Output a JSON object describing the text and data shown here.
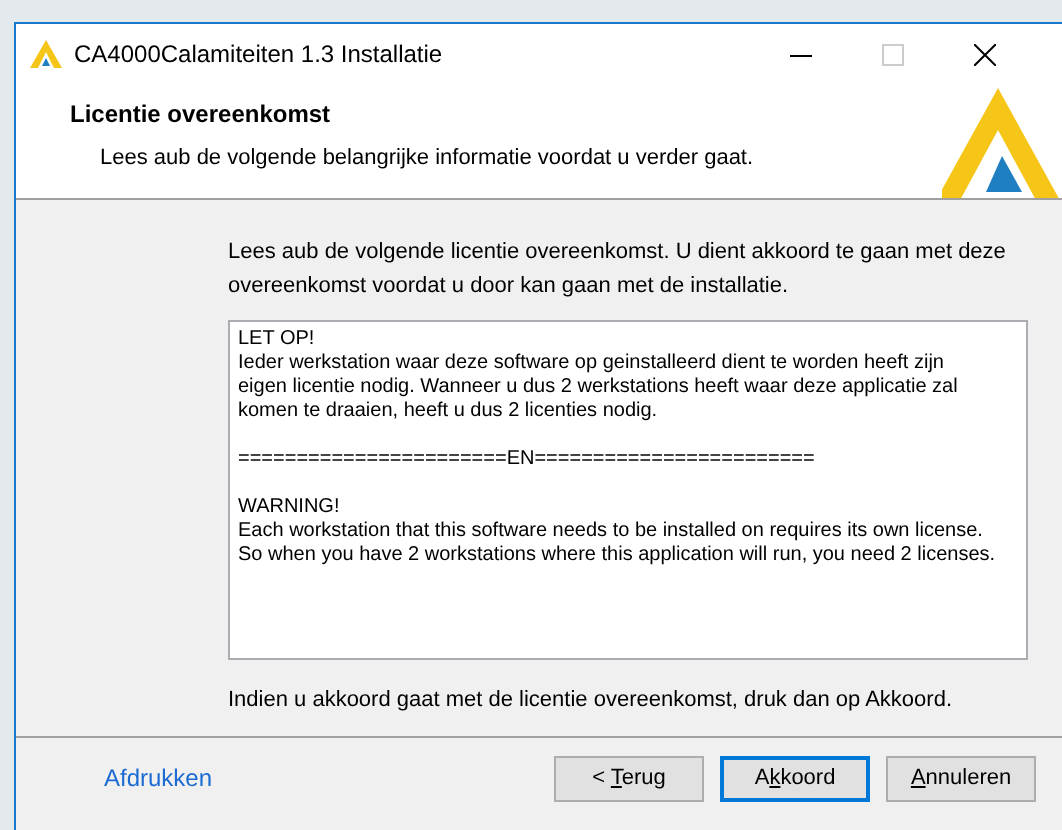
{
  "window": {
    "title": "CA4000Calamiteiten 1.3 Installatie"
  },
  "header": {
    "title": "Licentie overeenkomst",
    "subtitle": "Lees aub de volgende belangrijke informatie voordat u verder gaat."
  },
  "intro": "Lees aub de volgende licentie overeenkomst. U dient akkoord te gaan met deze overeenkomst voordat u door kan gaan met de installatie.",
  "license_text": [
    [
      "LET OP!",
      "Ieder werkstation waar deze software op geinstalleerd dient te worden heeft zijn",
      "eigen licentie nodig. Wanneer u dus 2 werkstations heeft waar deze applicatie zal",
      "komen te draaien, heeft u dus 2 licenties nodig."
    ],
    [
      "=======================EN========================"
    ],
    [
      "WARNING!",
      "Each workstation that this software needs to be installed on requires its own license.",
      "So when you have 2 workstations where this application will run, you need 2 licenses."
    ]
  ],
  "footer_note": "Indien u akkoord gaat met de licentie overeenkomst, druk dan op Akkoord.",
  "print_link": "Afdrukken",
  "buttons": [
    {
      "before": "< ",
      "key": "T",
      "after": "erug",
      "default": false
    },
    {
      "before": "A",
      "key": "k",
      "after": "koord",
      "default": true
    },
    {
      "key": "A",
      "after": "nnuleren",
      "default": false
    }
  ]
}
